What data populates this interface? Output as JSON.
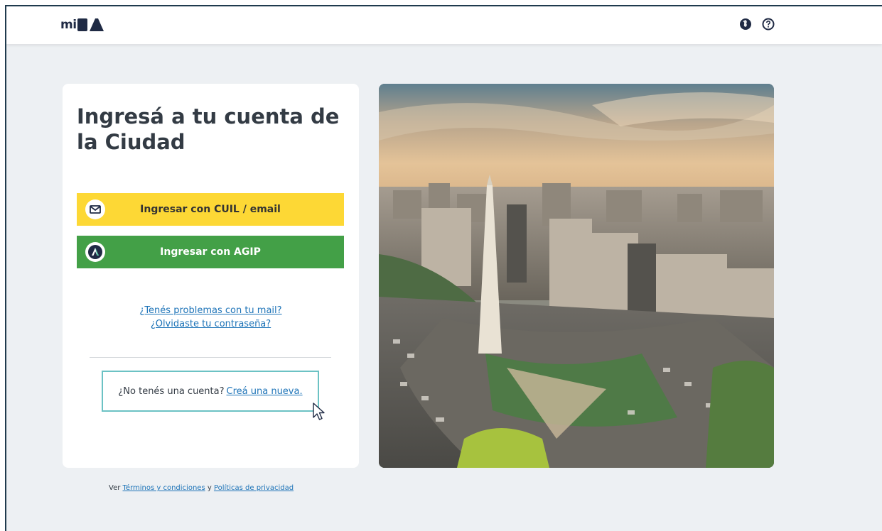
{
  "header": {
    "logo_prefix": "mi",
    "logo_suffix": "BA",
    "icons": [
      "globe-icon",
      "help-icon"
    ]
  },
  "login": {
    "title": "Ingresá a tu cuenta de la Ciudad",
    "cuil_button": "Ingresar con CUIL / email",
    "agip_button": "Ingresar con AGIP",
    "mail_problems_link": "¿Tenés problemas con tu mail?",
    "forgot_password_link": "¿Olvidaste tu contraseña?",
    "no_account_text": "¿No tenés una cuenta?",
    "create_account_link": "Creá una nueva."
  },
  "footer": {
    "prefix": "Ver",
    "terms_link": "Términos y condiciones",
    "conjunction": "y",
    "privacy_link": "Políticas de privacidad"
  },
  "colors": {
    "yellow_button": "#fdd835",
    "green_button": "#43a047",
    "link": "#1e74b8",
    "highlight_border": "#6cc2c4",
    "background": "#edf0f3"
  }
}
